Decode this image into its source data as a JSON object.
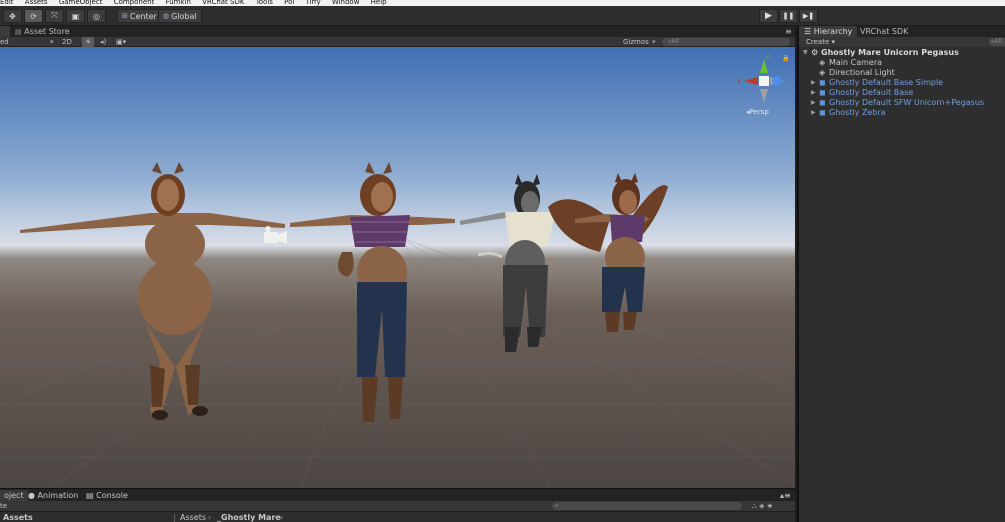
{
  "menu": [
    "Edit",
    "Assets",
    "GameObject",
    "Component",
    "Fumkin",
    "VRChat SDK",
    "Tools",
    "Pol",
    "Tiffy",
    "Window",
    "Help"
  ],
  "toolbar": {
    "tools": [
      "move",
      "rotate",
      "scale",
      "rect",
      "transform"
    ],
    "pivot_label": "Center",
    "space_label": "Global",
    "play_icons": [
      "▶",
      "❚❚",
      "▶❚"
    ]
  },
  "scene_tabs": {
    "scene": "",
    "asset_store": "Asset Store"
  },
  "scene_toolbar": {
    "shading": "ed",
    "mode_2d": "2D",
    "gizmos": "Gizmos",
    "search_placeholder": "All"
  },
  "viewport": {
    "persp_label": "Persp",
    "axis_labels": {
      "x": "x",
      "y": "y"
    }
  },
  "bottom": {
    "tabs": [
      "oject",
      "Animation",
      "Console"
    ],
    "create_label": "te",
    "assets_label": "Assets",
    "breadcrumb": [
      "Assets",
      "_Ghostly Mare"
    ]
  },
  "hierarchy": {
    "tabs": [
      "Hierarchy",
      "VRChat SDK"
    ],
    "create_label": "Create",
    "search_placeholder": "All",
    "scene_name": "Ghostly Mare Unicorn Pegasus",
    "items": [
      {
        "label": "Main Camera",
        "type": "object"
      },
      {
        "label": "Directional Light",
        "type": "object"
      },
      {
        "label": "Ghostly Default Base Simple",
        "type": "prefab"
      },
      {
        "label": "Ghostly Default Base",
        "type": "prefab"
      },
      {
        "label": "Ghostly Default SFW Unicorn+Pegasus",
        "type": "prefab"
      },
      {
        "label": "Ghostly Zebra",
        "type": "prefab"
      }
    ]
  },
  "colors": {
    "prefab": "#6f9fe0",
    "panel": "#2e2e2e",
    "accent": "#4d8fe6"
  }
}
